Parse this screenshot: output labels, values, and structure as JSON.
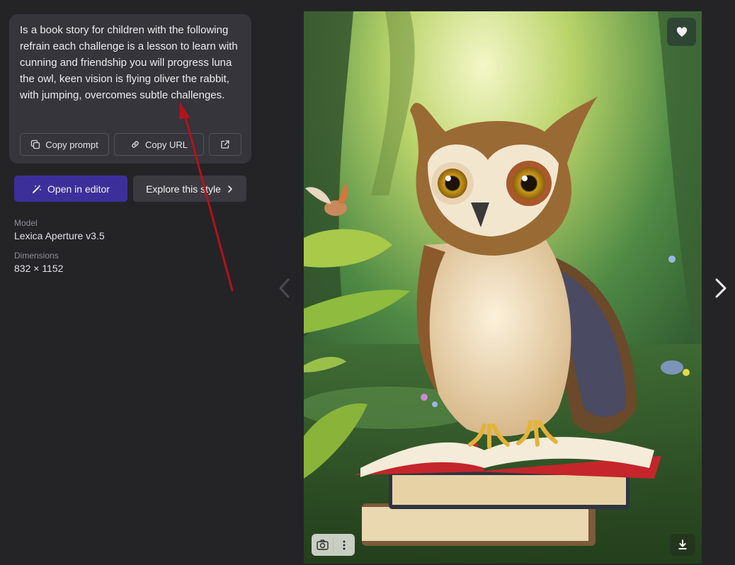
{
  "prompt": {
    "text": "Is a book story for children with the following refrain each challenge is a lesson to learn with cunning and friendship you will progress luna the owl, keen vision is flying oliver the rabbit, with jumping, overcomes subtle challenges.",
    "copy_prompt_label": "Copy prompt",
    "copy_url_label": "Copy URL",
    "open_external_icon": "external-link-icon"
  },
  "actions": {
    "open_editor_label": "Open in editor",
    "explore_style_label": "Explore this style"
  },
  "meta": {
    "model_label": "Model",
    "model_value": "Lexica Aperture v3.5",
    "dimensions_label": "Dimensions",
    "dimensions_value": "832 × 1152"
  },
  "colors": {
    "background": "#242427",
    "card": "#35353b",
    "accent_button": "#3c2f9a",
    "annotation_arrow": "#b3121b"
  },
  "icons": [
    "copy-icon",
    "link-icon",
    "external-link-icon",
    "magic-wand-icon",
    "chevron-right-icon",
    "chevron-left-icon",
    "heart-icon",
    "camera-search-icon",
    "more-vertical-icon",
    "download-icon"
  ]
}
